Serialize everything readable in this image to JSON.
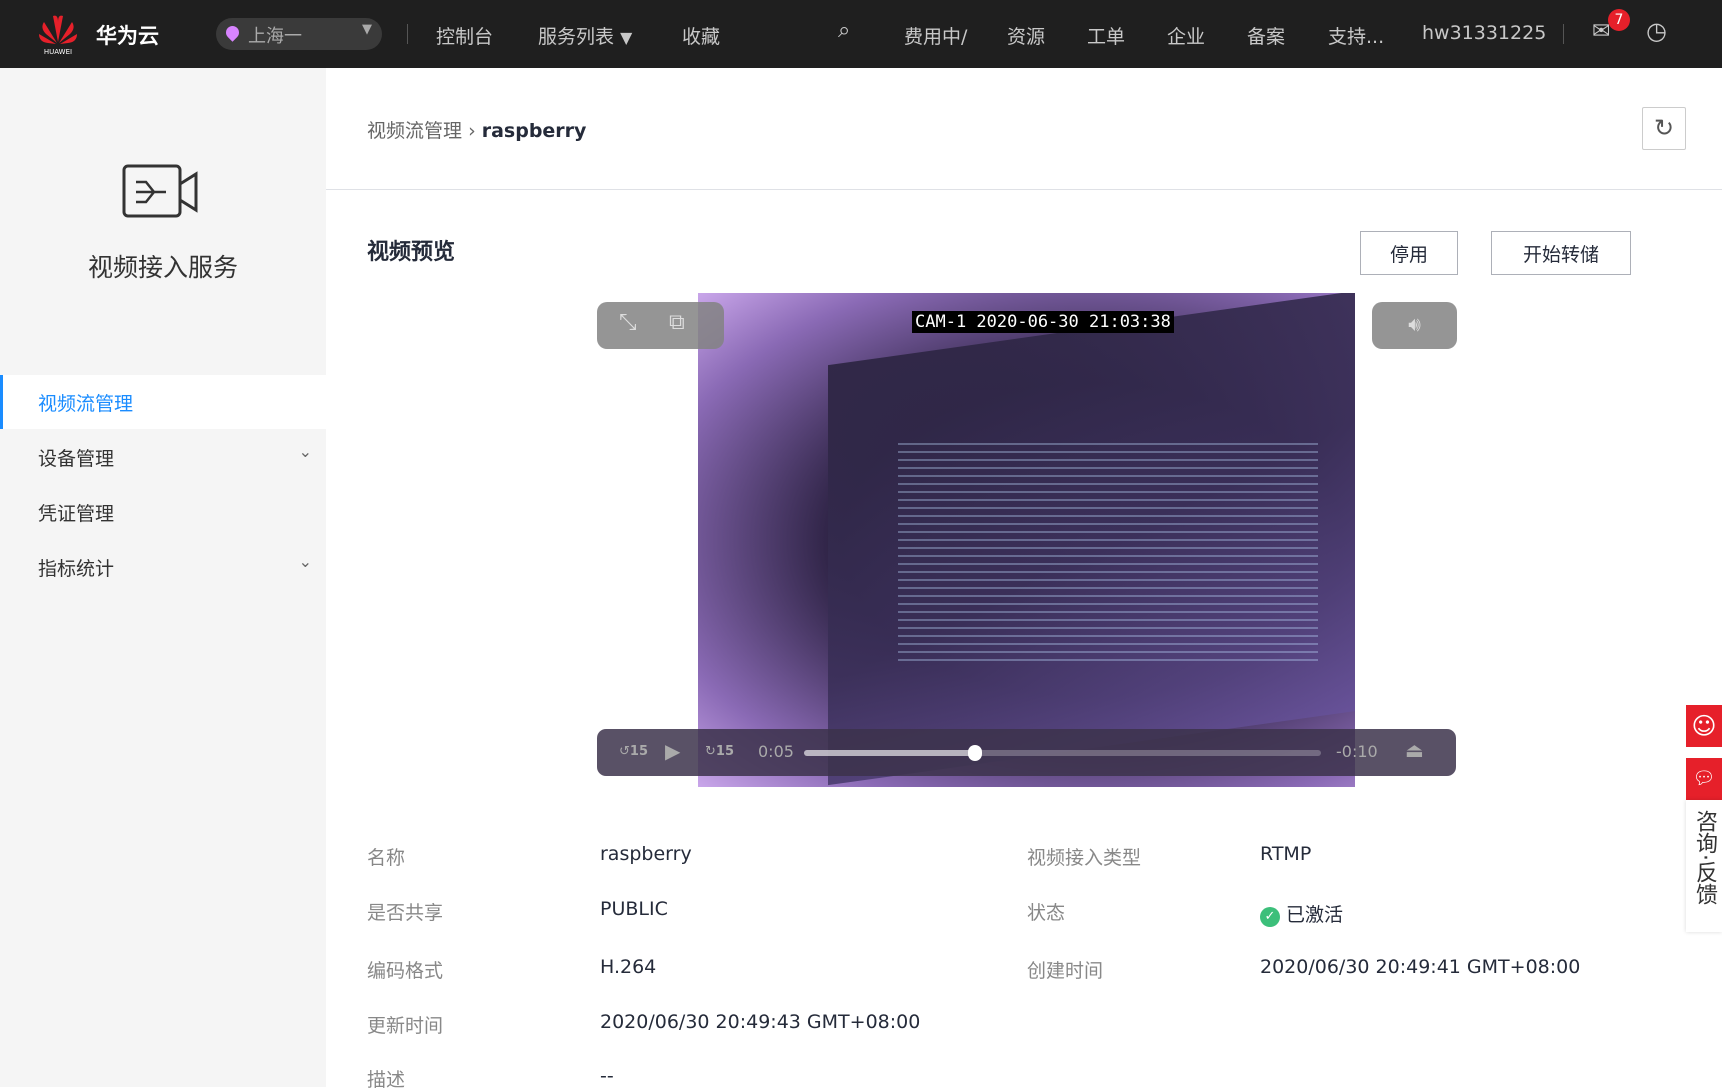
{
  "header": {
    "brand": "华为云",
    "logo_text": "HUAWEI",
    "region": "上海一",
    "nav": [
      "控制台",
      "服务列表",
      "收藏"
    ],
    "right": [
      "费用中/",
      "资源",
      "工单",
      "企业",
      "备案",
      "支持..."
    ],
    "user": "hw31331225",
    "mail_count": "7"
  },
  "sidebar": {
    "title": "视频接入服务",
    "items": [
      {
        "label": "视频流管理",
        "active": true
      },
      {
        "label": "设备管理",
        "expandable": true
      },
      {
        "label": "凭证管理"
      },
      {
        "label": "指标统计",
        "expandable": true
      }
    ]
  },
  "breadcrumb": {
    "parent": "视频流管理",
    "sep": "›",
    "current": "raspberry"
  },
  "section": {
    "title": "视频预览",
    "disable_btn": "停用",
    "dump_btn": "开始转储"
  },
  "video": {
    "osd": "CAM-1  2020-06-30 21:03:38",
    "elapsed": "0:05",
    "remaining": "-0:10",
    "progress_percent": 33,
    "skip": "15"
  },
  "details": {
    "name_label": "名称",
    "name": "raspberry",
    "type_label": "视频接入类型",
    "type": "RTMP",
    "share_label": "是否共享",
    "share": "PUBLIC",
    "status_label": "状态",
    "status": "已激活",
    "codec_label": "编码格式",
    "codec": "H.264",
    "created_label": "创建时间",
    "created": "2020/06/30 20:49:41 GMT+08:00",
    "updated_label": "更新时间",
    "updated": "2020/06/30 20:49:43 GMT+08:00",
    "desc_label": "描述",
    "desc": "--"
  },
  "feedback": {
    "label": "咨询·反馈"
  }
}
